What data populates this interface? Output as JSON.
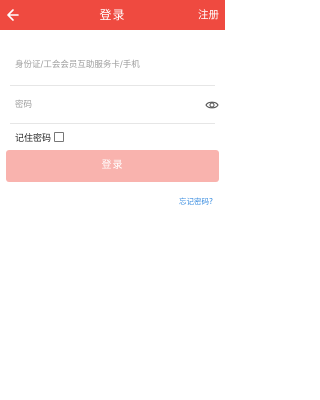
{
  "header": {
    "title": "登录",
    "register_label": "注册",
    "background": "#ef4a40"
  },
  "form": {
    "account_placeholder": "身份证/工会会员互助服务卡/手机",
    "password_placeholder": "密码",
    "remember_label": "记住密码",
    "remember_checked": false,
    "login_label": "登录",
    "login_color": "#f9b3ae",
    "forgot_label": "忘记密码?",
    "link_color": "#3a8de0"
  },
  "icons": {
    "back": "arrow-left-icon",
    "eye": "eye-icon"
  }
}
